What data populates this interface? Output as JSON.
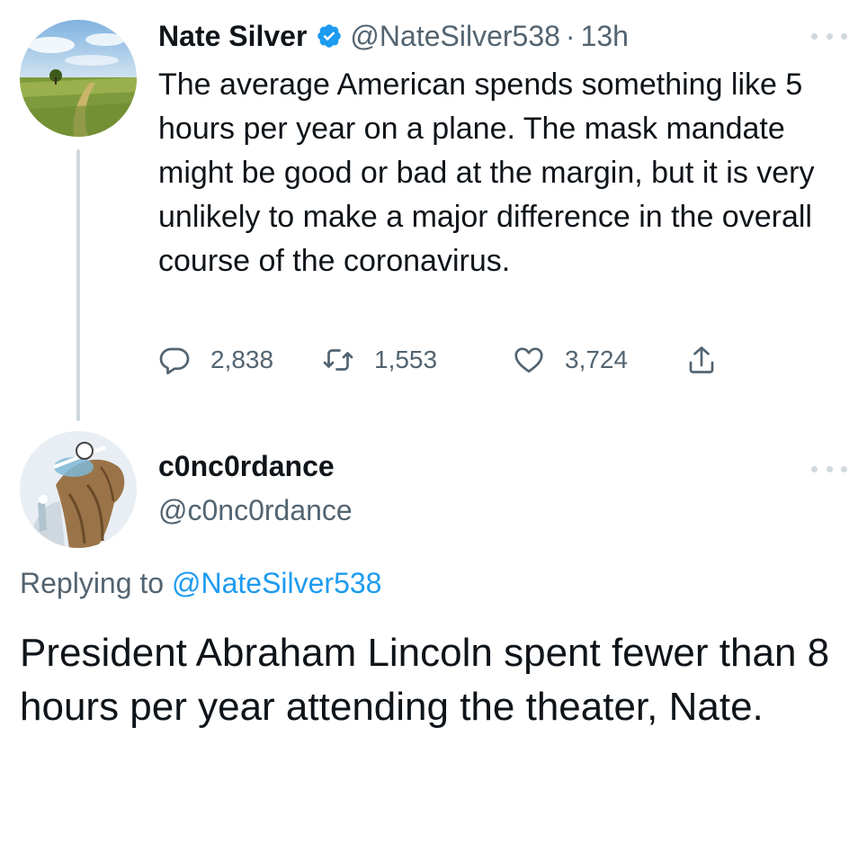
{
  "tweet1": {
    "name": "Nate Silver",
    "handle": "@NateSilver538",
    "separator": "·",
    "time": "13h",
    "text": "The average American spends something like 5 hours per year on a plane. The mask mandate might be good or bad at the margin, but it is very unlikely to make a major difference in the overall course of the coronavirus.",
    "replies": "2,838",
    "retweets": "1,553",
    "likes": "3,724",
    "icons": [
      "verified-icon",
      "reply-icon",
      "retweet-icon",
      "like-icon",
      "share-icon",
      "more-icon"
    ]
  },
  "tweet2": {
    "name": "c0nc0rdance",
    "handle": "@c0nc0rdance",
    "replying_label": "Replying to",
    "replying_to": "@NateSilver538",
    "text": "President Abraham Lincoln spent fewer than 8 hours per year attending the theater, Nate."
  },
  "colors": {
    "text": "#0f1419",
    "secondary": "#536471",
    "link": "#1d9bf0",
    "thread_line": "#cfd9de"
  }
}
